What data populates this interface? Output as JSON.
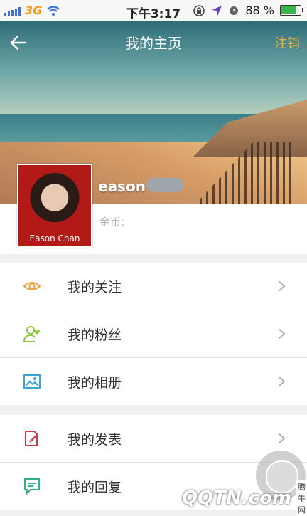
{
  "status_bar": {
    "carrier": "3G",
    "time": "下午3:17",
    "battery_percent": "88 %",
    "battery_level": 0.88
  },
  "nav": {
    "title": "我的主页",
    "logout_label": "注销"
  },
  "profile": {
    "avatar_caption": "Eason Chan",
    "username": "eason",
    "coins_label": "金币:"
  },
  "menu_groups": [
    [
      {
        "label": "我的关注",
        "icon": "eye-icon",
        "color": "#e3a23c"
      },
      {
        "label": "我的粉丝",
        "icon": "user-heart-icon",
        "color": "#8cc63f"
      },
      {
        "label": "我的相册",
        "icon": "image-icon",
        "color": "#3aa6d8"
      }
    ],
    [
      {
        "label": "我的发表",
        "icon": "edit-document-icon",
        "color": "#d8384a"
      },
      {
        "label": "我的回复",
        "icon": "chat-icon",
        "color": "#32b08c"
      }
    ]
  ],
  "watermark": {
    "text": "QQTN.com",
    "sub": "腾牛网"
  }
}
